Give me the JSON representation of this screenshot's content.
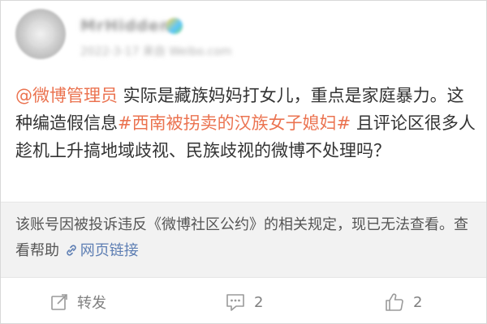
{
  "post": {
    "mention": "@微博管理员",
    "text_1": " 实际是藏族妈妈打女儿，重点是家庭暴力。这种编造假信息",
    "hashtag": "#西南被拐卖的汉族女子媳妇#",
    "text_2": " 且评论区很多人趁机上升搞地域歧视、民族歧视的微博不处理吗？"
  },
  "notice": {
    "text": "该账号因被投诉违反《微博社区公约》的相关规定，现已无法查看。查看帮助",
    "link_label": "网页链接"
  },
  "actions": {
    "repost_label": "转发",
    "comment_count": "2",
    "like_count": "2"
  },
  "colors": {
    "link": "#eb7350",
    "notice_link": "#5d7eb3",
    "notice_bg": "#f2f2f2"
  },
  "icons": [
    "repost-icon",
    "comment-icon",
    "like-icon",
    "link-icon"
  ]
}
